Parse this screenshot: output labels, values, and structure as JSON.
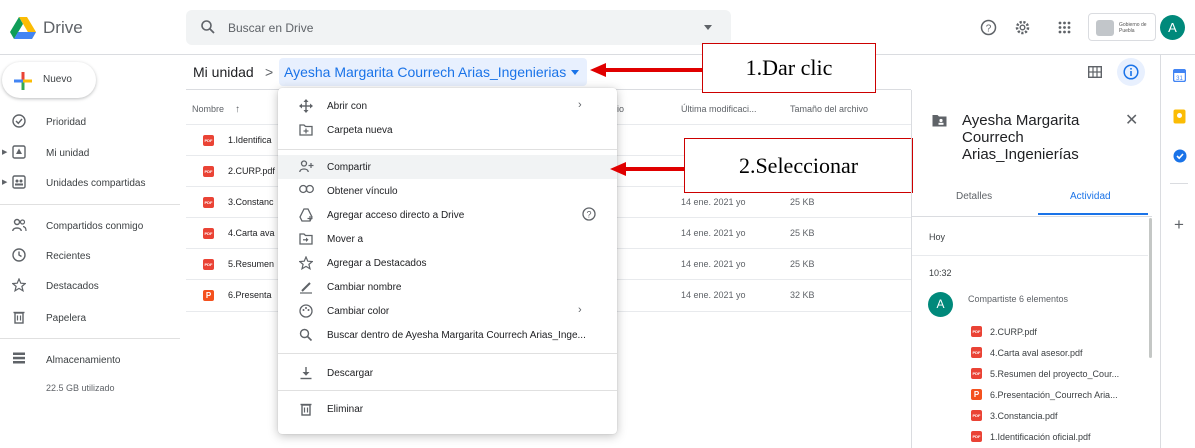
{
  "app": {
    "name": "Drive"
  },
  "search": {
    "placeholder": "Buscar en Drive"
  },
  "org": {
    "badge_text": "Gobierno de Puebla"
  },
  "user": {
    "initial": "A"
  },
  "sidebar": {
    "new_label": "Nuevo",
    "items": [
      {
        "label": "Prioridad",
        "icon": "priority-icon"
      },
      {
        "label": "Mi unidad",
        "icon": "my-drive-icon"
      },
      {
        "label": "Unidades compartidas",
        "icon": "shared-drives-icon"
      },
      {
        "label": "Compartidos conmigo",
        "icon": "shared-with-me-icon"
      },
      {
        "label": "Recientes",
        "icon": "clock-icon"
      },
      {
        "label": "Destacados",
        "icon": "star-icon"
      },
      {
        "label": "Papelera",
        "icon": "trash-icon"
      },
      {
        "label": "Almacenamiento",
        "icon": "storage-icon"
      }
    ],
    "storage_used": "22.5 GB utilizado"
  },
  "breadcrumb": {
    "root": "Mi unidad",
    "separator": ">",
    "current": "Ayesha Margarita Courrech Arias_Ingenierias"
  },
  "table": {
    "headers": {
      "name": "Nombre",
      "modified": "Última modificaci...",
      "size": "Tamaño del archivo"
    },
    "rows": [
      {
        "name": "1.Identifica",
        "modified": "",
        "size": "",
        "type": "pdf"
      },
      {
        "name": "2.CURP.pdf",
        "modified": "",
        "size": "",
        "type": "pdf"
      },
      {
        "name": "3.Constanc",
        "modified": "14 ene. 2021 yo",
        "size": "25 KB",
        "type": "pdf"
      },
      {
        "name": "4.Carta ava",
        "modified": "14 ene. 2021 yo",
        "size": "25 KB",
        "type": "pdf"
      },
      {
        "name": "5.Resumen",
        "modified": "14 ene. 2021 yo",
        "size": "25 KB",
        "type": "pdf"
      },
      {
        "name": "6.Presenta",
        "modified": "14 ene. 2021 yo",
        "size": "32 KB",
        "type": "ppt"
      }
    ],
    "partial_header": "io"
  },
  "context_menu": {
    "items": [
      {
        "label": "Abrir con",
        "icon": "open-with-icon"
      },
      {
        "label": "Carpeta nueva",
        "icon": "new-folder-icon"
      },
      {
        "label": "Compartir",
        "icon": "share-person-icon"
      },
      {
        "label": "Obtener vínculo",
        "icon": "link-icon"
      },
      {
        "label": "Agregar acceso directo a Drive",
        "icon": "add-shortcut-icon"
      },
      {
        "label": "Mover a",
        "icon": "move-icon"
      },
      {
        "label": "Agregar a Destacados",
        "icon": "star-icon"
      },
      {
        "label": "Cambiar nombre",
        "icon": "pencil-icon"
      },
      {
        "label": "Cambiar color",
        "icon": "palette-icon"
      },
      {
        "label": "Buscar dentro de Ayesha Margarita Courrech Arias_Inge...",
        "icon": "search-icon"
      },
      {
        "label": "Descargar",
        "icon": "download-icon"
      },
      {
        "label": "Eliminar",
        "icon": "trash-icon"
      }
    ]
  },
  "annotations": {
    "step1": "1.Dar clic",
    "step2": "2.Seleccionar",
    "arrow_color": "#e00000"
  },
  "details_panel": {
    "title": "Ayesha Margarita Courrech Arias_Ingenierías",
    "tabs": [
      "Detalles",
      "Actividad"
    ],
    "day": "Hoy",
    "time": "10:32",
    "actor_initial": "A",
    "activity": "Compartiste 6 elementos",
    "files": [
      {
        "name": "2.CURP.pdf",
        "type": "pdf"
      },
      {
        "name": "4.Carta aval asesor.pdf",
        "type": "pdf"
      },
      {
        "name": "5.Resumen del proyecto_Cour...",
        "type": "pdf"
      },
      {
        "name": "6.Presentación_Courrech Aria...",
        "type": "ppt"
      },
      {
        "name": "3.Constancia.pdf",
        "type": "pdf"
      },
      {
        "name": "1.Identificación oficial.pdf",
        "type": "pdf"
      }
    ]
  },
  "colors": {
    "accent": "#1a73e8",
    "pdf_red": "#ea4335",
    "ppt_orange": "#f4511e",
    "avatar_teal": "#00897b"
  }
}
